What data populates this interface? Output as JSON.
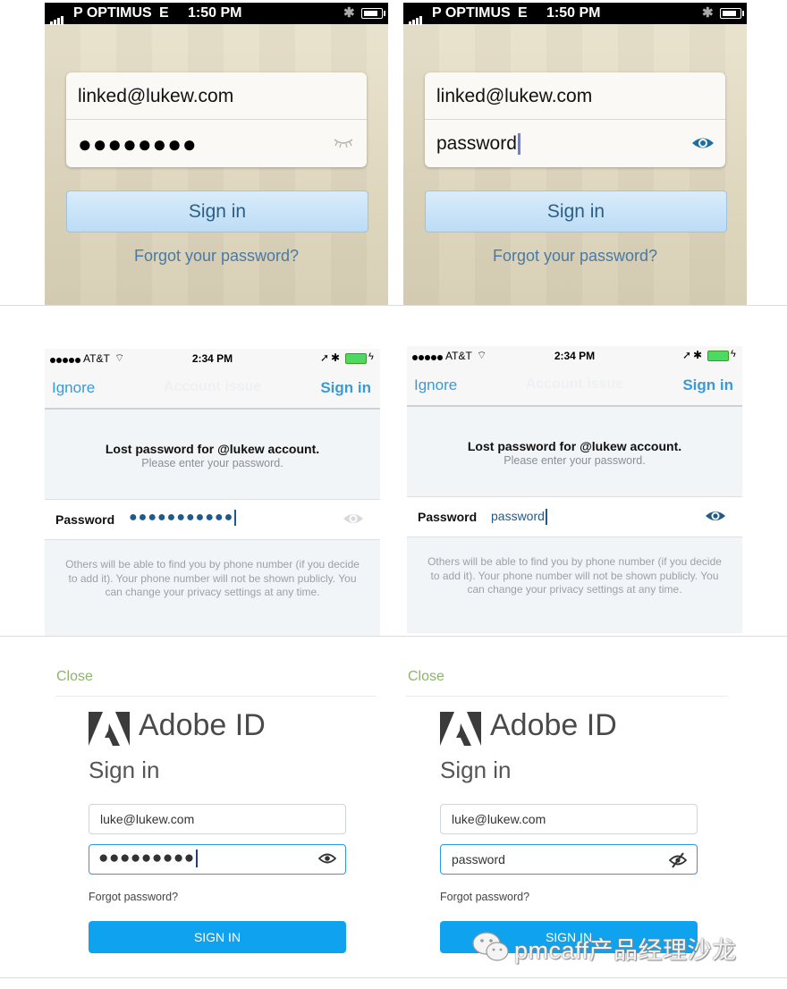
{
  "row1": {
    "left": {
      "status": {
        "carrier": "P OPTIMUS",
        "network": "E",
        "time": "1:50 PM"
      },
      "email": "linked@lukew.com",
      "password_masked": "●●●●●●●●",
      "sign_in": "Sign in",
      "forgot": "Forgot your password?",
      "eye_icon": "eye-closed"
    },
    "right": {
      "status": {
        "carrier": "P OPTIMUS",
        "network": "E",
        "time": "1:50 PM"
      },
      "email": "linked@lukew.com",
      "password_plain": "password",
      "sign_in": "Sign in",
      "forgot": "Forgot your password?",
      "eye_icon": "eye-open"
    }
  },
  "row2": {
    "left": {
      "status": {
        "carrier": "AT&T",
        "time": "2:34 PM"
      },
      "nav": {
        "left": "Ignore",
        "title": "Account issue",
        "right": "Sign in"
      },
      "heading": "Lost password for @lukew account.",
      "subheading": "Please enter your password.",
      "field_label": "Password",
      "field_value": "●●●●●●●●●●●",
      "note": "Others will be able to find you by phone number (if you decide to add it). Your phone number will not be shown publicly. You can change your privacy settings at any time."
    },
    "right": {
      "status": {
        "carrier": "AT&T",
        "time": "2:34 PM"
      },
      "nav": {
        "left": "Ignore",
        "title": "Account issue",
        "right": "Sign in"
      },
      "heading": "Lost password for @lukew account.",
      "subheading": "Please enter your password.",
      "field_label": "Password",
      "field_value": "password",
      "note": "Others will be able to find you by phone number (if you decide to add it). Your phone number will not be shown publicly. You can change your privacy settings at any time."
    }
  },
  "row3": {
    "left": {
      "close": "Close",
      "brand": "Adobe ID",
      "title": "Sign in",
      "email": "luke@lukew.com",
      "password_masked": "●●●●●●●●●",
      "forgot": "Forgot password?",
      "button": "SIGN IN"
    },
    "right": {
      "close": "Close",
      "brand": "Adobe ID",
      "title": "Sign in",
      "email": "luke@lukew.com",
      "password_plain": "password",
      "forgot": "Forgot password?",
      "button": "SIGN IN"
    }
  },
  "watermark": {
    "text": "pmcaff产品经理沙龙",
    "icon": "wechat-icon"
  },
  "colors": {
    "ios7_blue": "#3a9ad8",
    "adobe_blue": "#0ea2ef",
    "adobe_close_green": "#8db36c"
  }
}
